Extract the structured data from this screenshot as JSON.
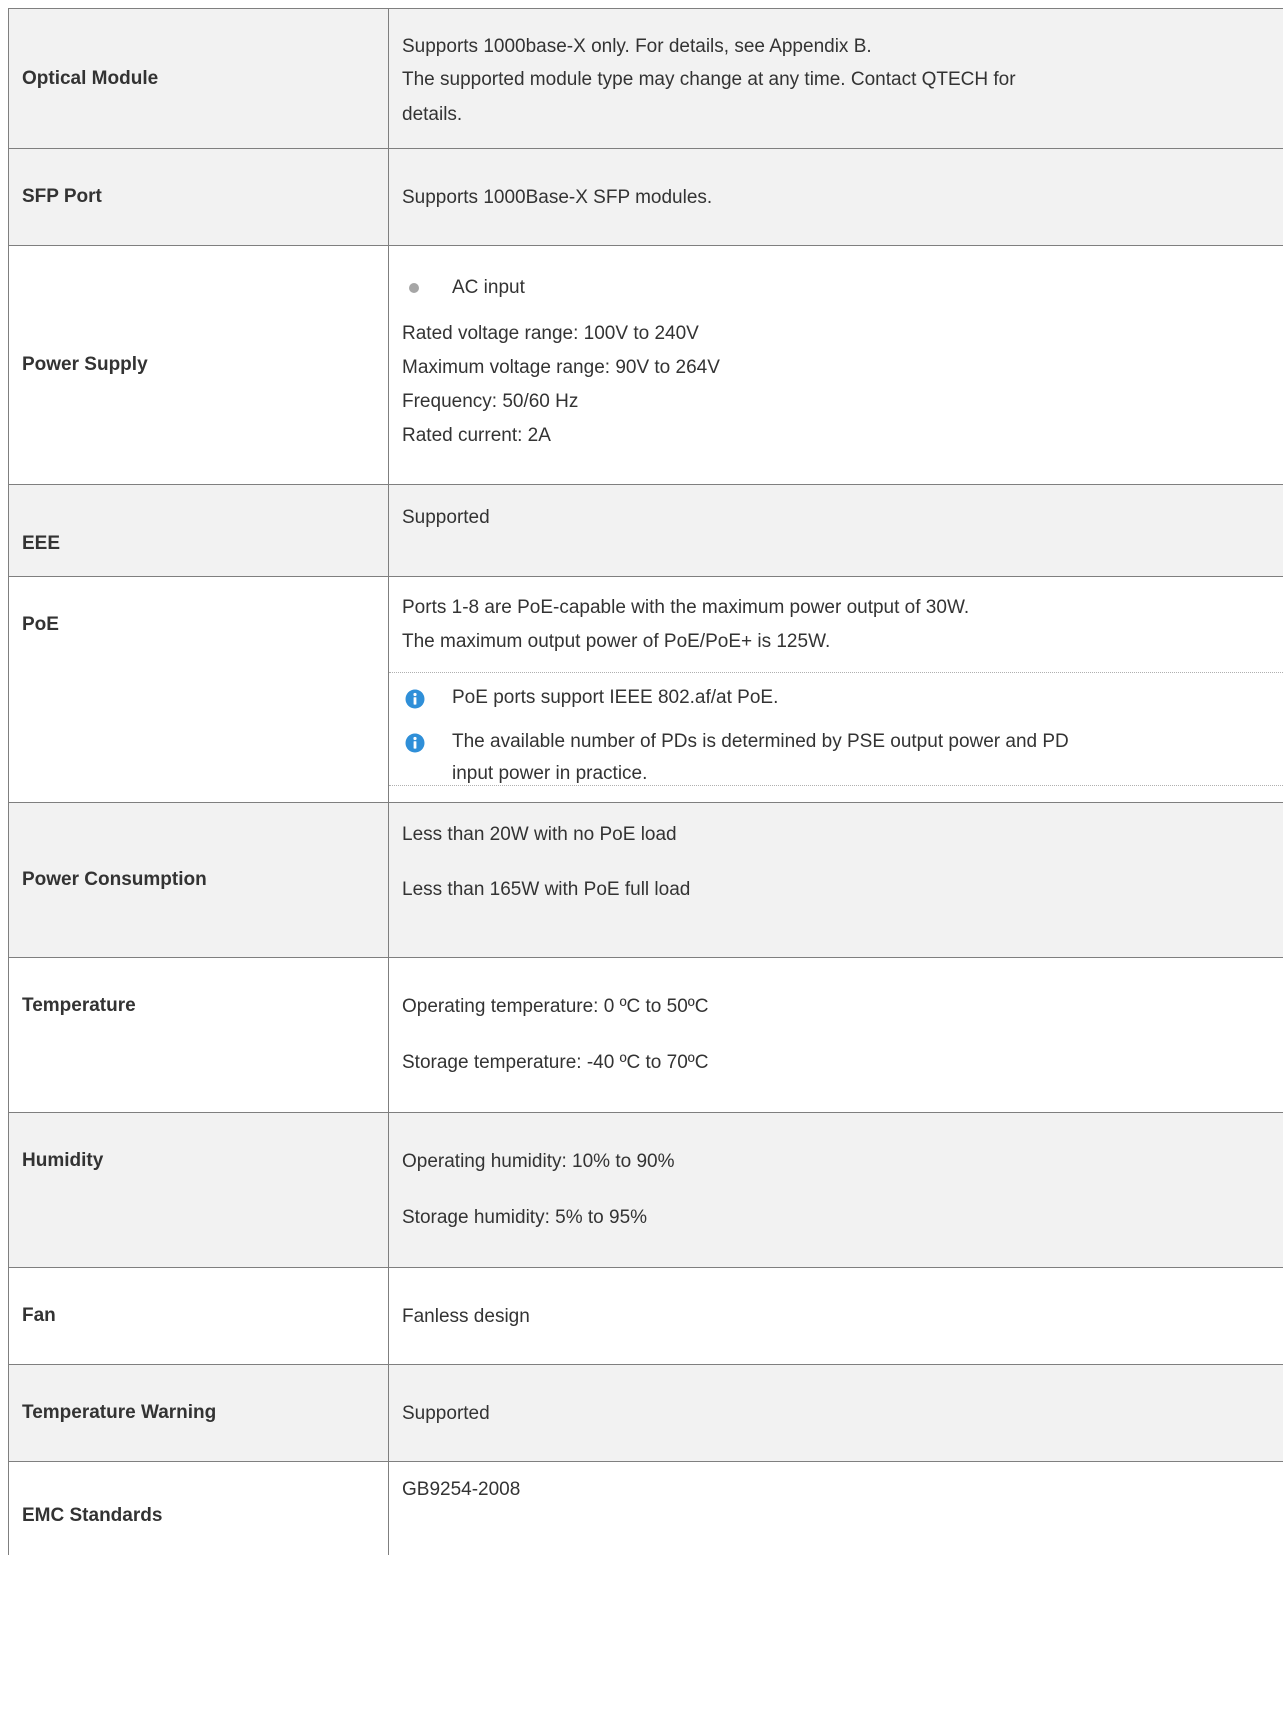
{
  "table": {
    "rows": [
      {
        "label": "Optical Module",
        "lines": [
          "Supports 1000base-X only. For details, see Appendix B.",
          "The supported module type may change at any time. Contact QTECH for",
          "details."
        ]
      },
      {
        "label": "SFP Port",
        "lines": [
          "Supports 1000Base-X SFP modules."
        ]
      },
      {
        "label": "Power Supply",
        "bullet": "AC input",
        "lines": [
          "Rated voltage range: 100V to 240V",
          "Maximum voltage range: 90V to 264V",
          "Frequency: 50/60 Hz",
          "Rated current: 2A"
        ]
      },
      {
        "label": "EEE",
        "lines": [
          "Supported"
        ]
      },
      {
        "label": "PoE",
        "lines": [
          "Ports 1-8 are PoE-capable with the maximum power output of 30W.",
          "The maximum output power of PoE/PoE+ is 125W."
        ],
        "notes": [
          "PoE ports support IEEE 802.af/at PoE.",
          "The available number of PDs is determined by PSE output power and PD",
          "input power in practice."
        ]
      },
      {
        "label": "Power Consumption",
        "lines": [
          "Less than 20W with no PoE load",
          "Less than 165W with PoE full load"
        ]
      },
      {
        "label": "Temperature",
        "lines": [
          "Operating temperature: 0 ºC to 50ºC",
          "Storage temperature: -40 ºC to 70ºC"
        ]
      },
      {
        "label": "Humidity",
        "lines": [
          "Operating humidity: 10% to 90%",
          "Storage humidity: 5% to 95%"
        ]
      },
      {
        "label": "Fan",
        "lines": [
          "Fanless design"
        ]
      },
      {
        "label": "Temperature Warning",
        "lines": [
          "Supported"
        ]
      },
      {
        "label": "EMC Standards",
        "lines": [
          "GB9254-2008"
        ]
      }
    ]
  },
  "colors": {
    "shade": "#f2f2f2",
    "border": "#7f7f7f",
    "text": "#333333",
    "info_icon": "#2f8fd8"
  },
  "icons": {
    "bullet": "bullet-dot",
    "note": "info-icon"
  }
}
